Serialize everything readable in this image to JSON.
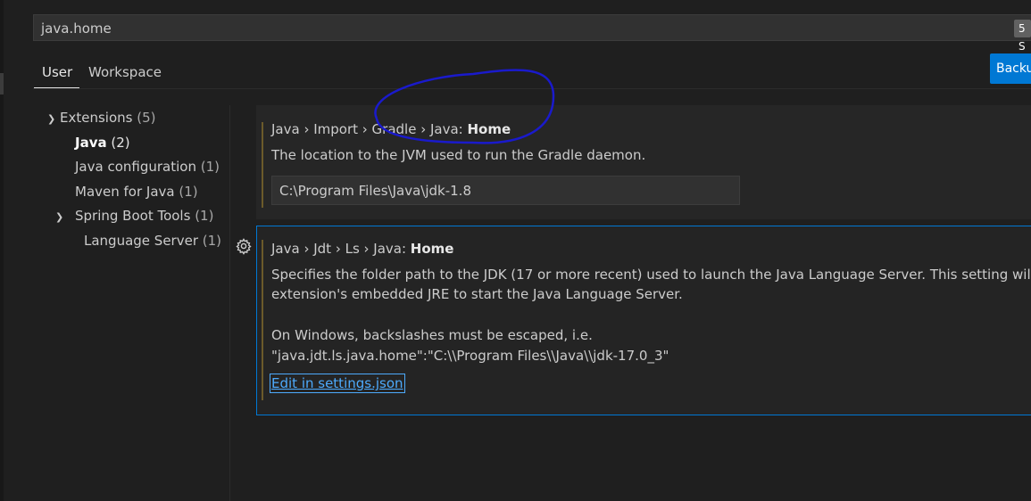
{
  "search": {
    "value": "java.home",
    "result_count": "5 S"
  },
  "tabs": [
    {
      "label": "User"
    },
    {
      "label": "Workspace"
    }
  ],
  "backup_button": {
    "label": "Backu"
  },
  "toc": {
    "extensions": {
      "label": "Extensions",
      "count": "(5)"
    },
    "java": {
      "label": "Java",
      "count": "(2)"
    },
    "java_configuration": {
      "label": "Java configuration",
      "count": "(1)"
    },
    "maven_for_java": {
      "label": "Maven for Java",
      "count": "(1)"
    },
    "spring_boot_tools": {
      "label": "Spring Boot Tools",
      "count": "(1)"
    },
    "language_server": {
      "label": "Language Server",
      "count": "(1)"
    }
  },
  "settings": [
    {
      "category_path": "Java › Import › Gradle › Java: ",
      "key": "Home",
      "description": "The location to the JVM used to run the Gradle daemon.",
      "value": "C:\\Program Files\\Java\\jdk-1.8"
    },
    {
      "category_path": "Java › Jdt › Ls › Java: ",
      "key": "Home",
      "description_line1": "Specifies the folder path to the JDK (17 or more recent) used to launch the Java Language Server. This setting will replac",
      "description_line2": "extension's embedded JRE to start the Java Language Server.",
      "description_line3": "On Windows, backslashes must be escaped, i.e.",
      "description_line4": "\"java.jdt.ls.java.home\":\"C:\\\\Program Files\\\\Java\\\\jdk-17.0_3\"",
      "link_label": "Edit in settings.json"
    }
  ],
  "colors": {
    "accent": "#0078d4",
    "link": "#4daafc",
    "annotation_ink": "#1a1acc"
  }
}
